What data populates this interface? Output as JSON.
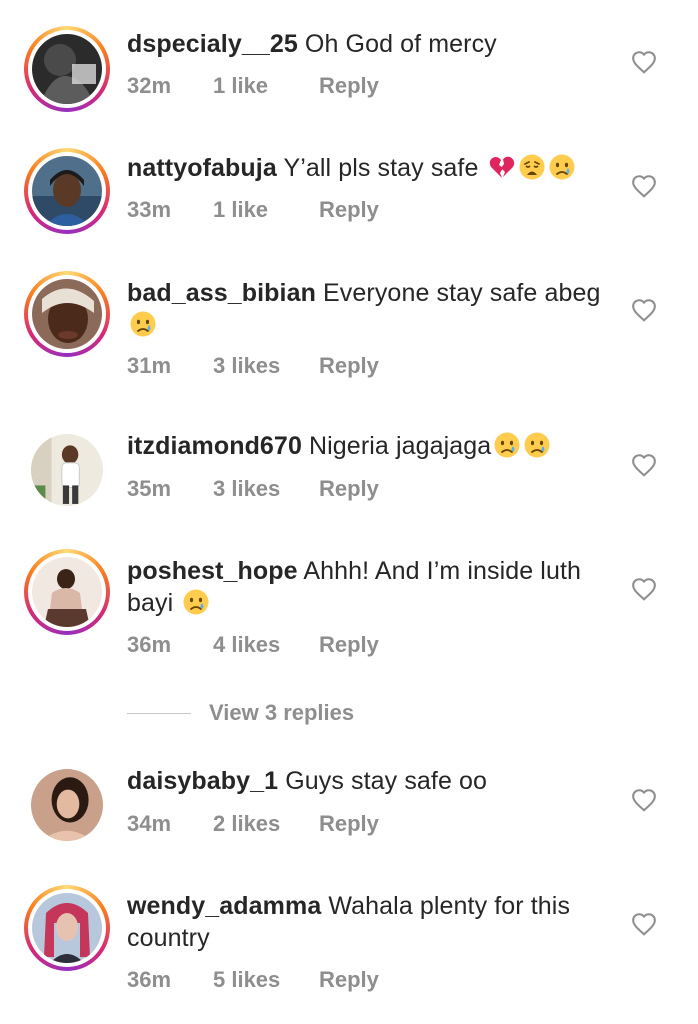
{
  "comments": [
    {
      "username": "dspecialy__25",
      "text": "Oh God of mercy",
      "emojis": [],
      "time": "32m",
      "likes": "1 like",
      "reply": "Reply"
    },
    {
      "username": "nattyofabuja",
      "text": "Y’all pls stay safe",
      "emojis": [
        "broken-heart-emoji",
        "weary-face-emoji",
        "crying-face-emoji"
      ],
      "time": "33m",
      "likes": "1 like",
      "reply": "Reply"
    },
    {
      "username": "bad_ass_bibian",
      "text": "Everyone stay safe abeg",
      "emojis": [
        "crying-face-emoji"
      ],
      "time": "31m",
      "likes": "3 likes",
      "reply": "Reply"
    },
    {
      "username": "itzdiamond670",
      "text": "Nigeria jagajaga",
      "emojis": [
        "crying-face-emoji",
        "crying-face-emoji"
      ],
      "time": "35m",
      "likes": "3 likes",
      "reply": "Reply"
    },
    {
      "username": "poshest_hope",
      "text": "Ahhh! And I’m inside luth bayi",
      "emojis": [
        "crying-face-emoji"
      ],
      "time": "36m",
      "likes": "4 likes",
      "reply": "Reply"
    },
    {
      "username": "daisybaby_1",
      "text": "Guys stay safe oo",
      "emojis": [],
      "time": "34m",
      "likes": "2 likes",
      "reply": "Reply"
    },
    {
      "username": "wendy_adamma",
      "text": "Wahala plenty for this country",
      "emojis": [],
      "time": "36m",
      "likes": "5 likes",
      "reply": "Reply"
    }
  ],
  "view_replies": "View 3 replies",
  "icons": {
    "like": "heart-outline-icon"
  },
  "colors": {
    "text": "#262626",
    "meta": "#8e8e8e",
    "story_ring_start": "#feda75",
    "story_ring_end": "#d62976"
  }
}
